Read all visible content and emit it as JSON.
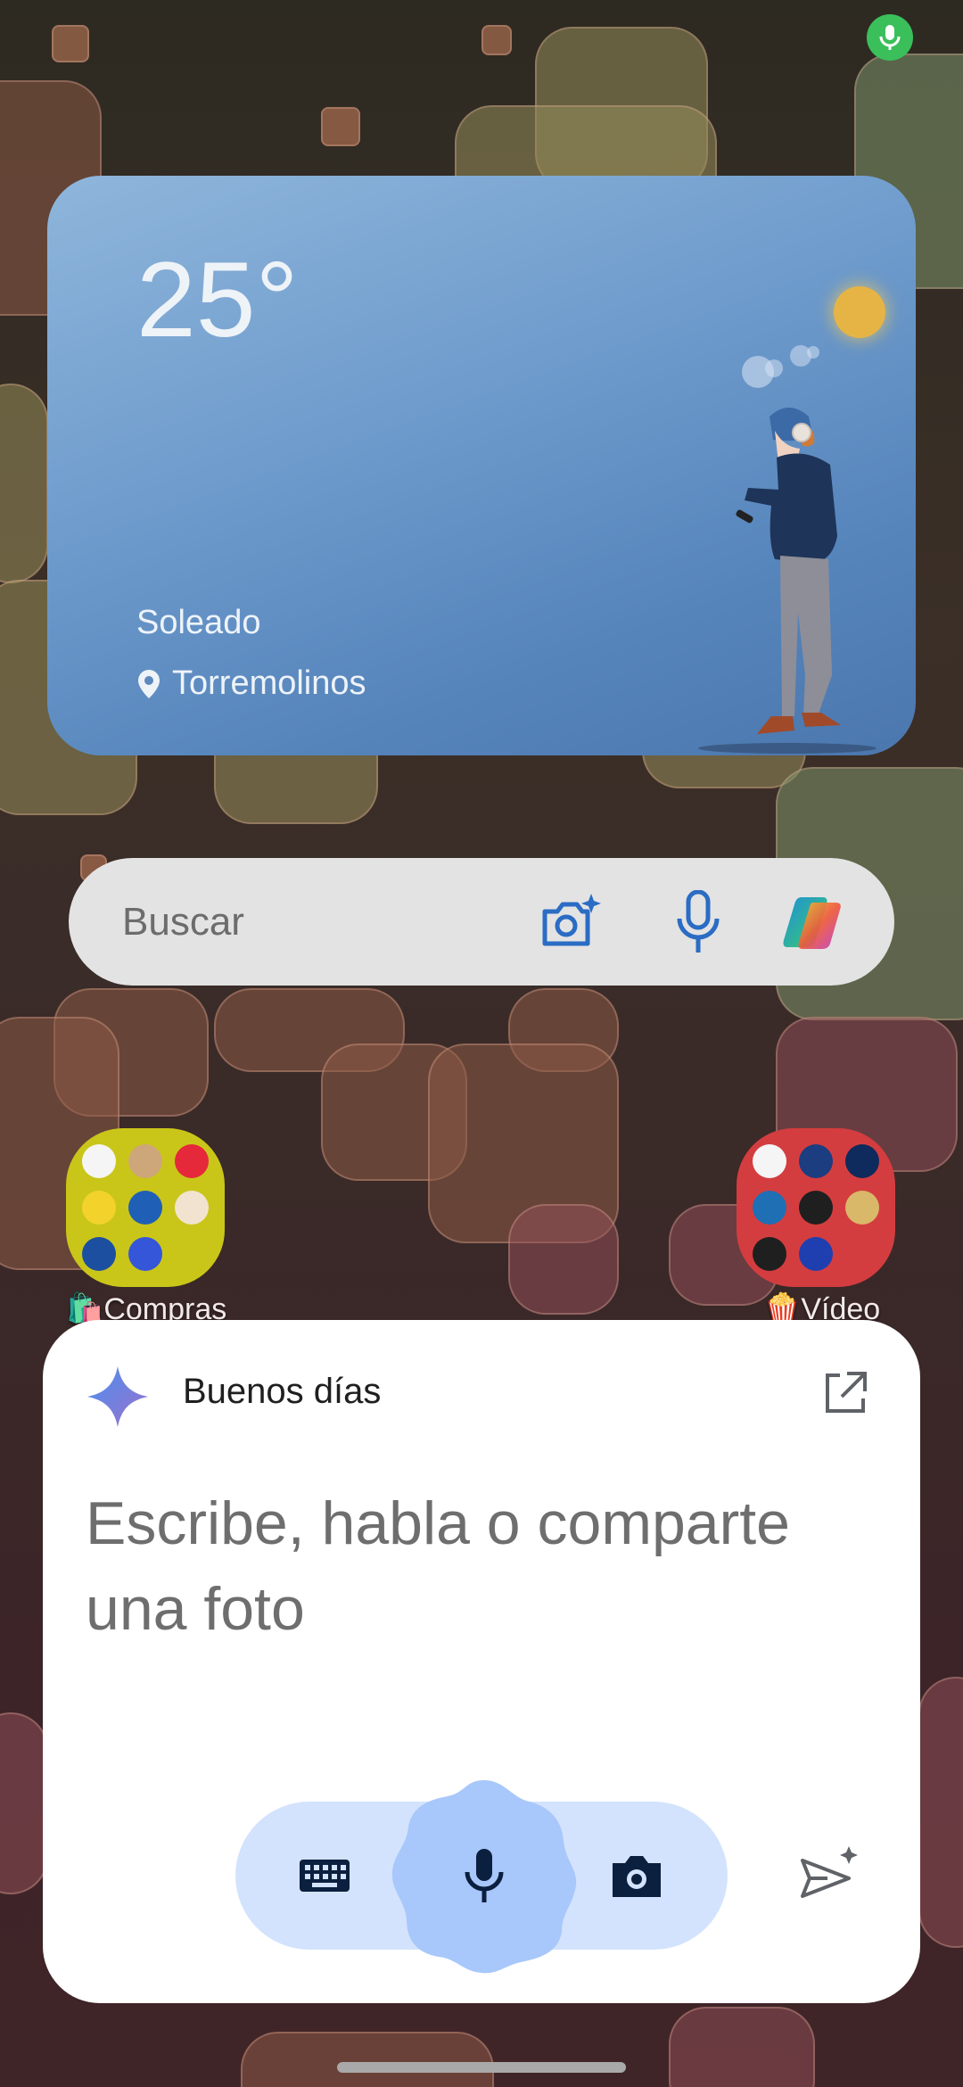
{
  "status": {
    "mic_indicator_icon": "mic-icon",
    "mic_indicator_color": "#3bbf5b"
  },
  "weather": {
    "temperature": "25°",
    "condition": "Soleado",
    "location": "Torremolinos",
    "location_icon": "location-pin-icon",
    "colors": {
      "card_top": "#8fb6db",
      "card_bottom": "#4b77ae",
      "sun": "#e6b445"
    }
  },
  "search": {
    "placeholder": "Buscar",
    "icons": [
      "lens-camera-icon",
      "mic-icon",
      "copilot-icon"
    ]
  },
  "folders": [
    {
      "label": "Compras",
      "emoji": "🛍️",
      "color": "#c9c619"
    },
    {
      "label": "Vídeo",
      "emoji": "🍿",
      "color": "#d43d3f"
    }
  ],
  "assistant": {
    "greeting": "Buenos días",
    "prompt": "Escribe, habla o comparte una foto",
    "icons": {
      "brand": "gemini-sparkle-icon",
      "open": "open-external-icon",
      "keyboard": "keyboard-icon",
      "mic": "mic-icon",
      "camera": "camera-icon",
      "send": "send-sparkle-icon"
    },
    "colors": {
      "controls_bg": "#d3e3fd",
      "mic_bg": "#a8c7fa"
    }
  }
}
